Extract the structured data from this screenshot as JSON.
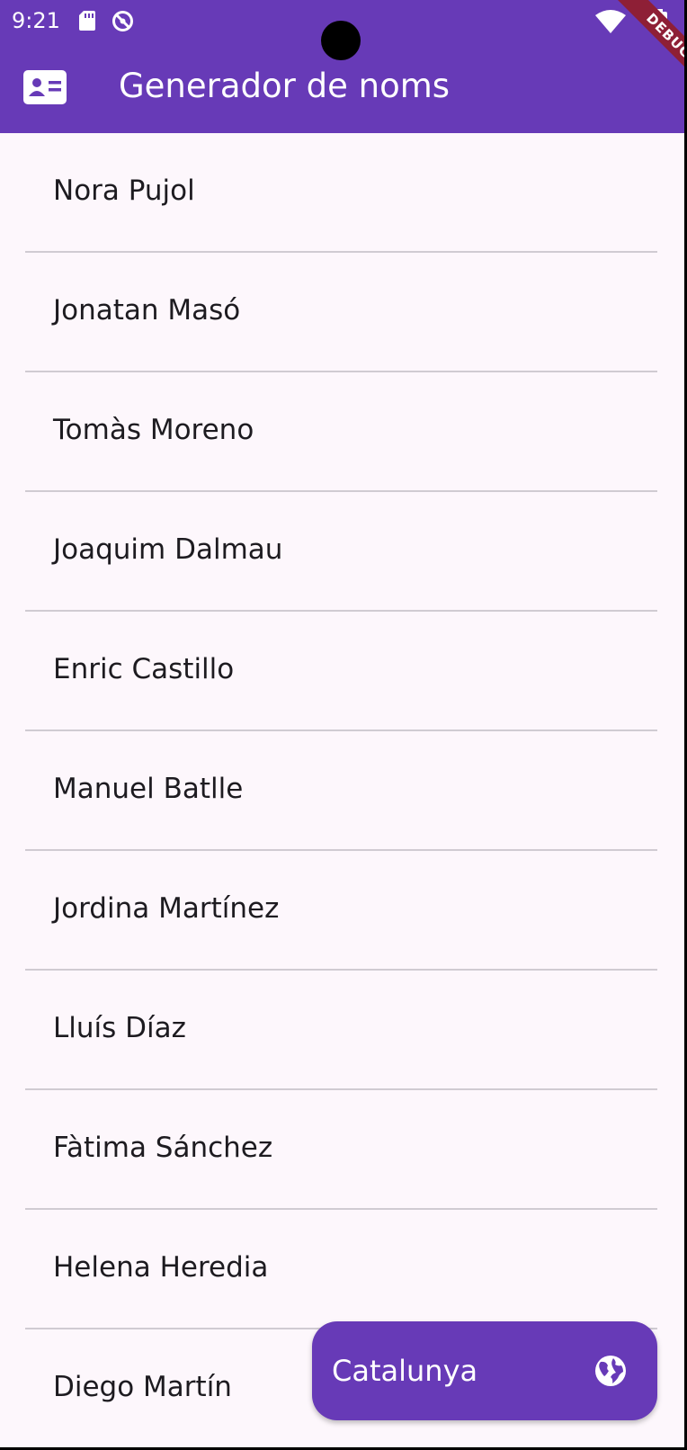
{
  "status_bar": {
    "time": "9:21",
    "icons": [
      "sd-card-icon",
      "sync-disabled-icon",
      "wifi-icon",
      "battery-icon"
    ]
  },
  "debug_banner": "DEBUG",
  "app_bar": {
    "title": "Generador de noms",
    "leading_icon": "id-card-icon",
    "background": "#673ab7"
  },
  "names": [
    "Nora Pujol",
    "Jonatan Masó",
    "Tomàs Moreno",
    "Joaquim Dalmau",
    "Enric Castillo",
    "Manuel Batlle",
    "Jordina Martínez",
    "Lluís Díaz",
    "Fàtima Sánchez",
    "Helena Heredia",
    "Diego Martín"
  ],
  "fab": {
    "label": "Catalunya",
    "icon": "globe-icon",
    "background": "#673ab7"
  },
  "colors": {
    "accent": "#673ab7",
    "surface": "#fdf7fc",
    "divider": "#d0cbd2",
    "text": "#1d1b20"
  }
}
